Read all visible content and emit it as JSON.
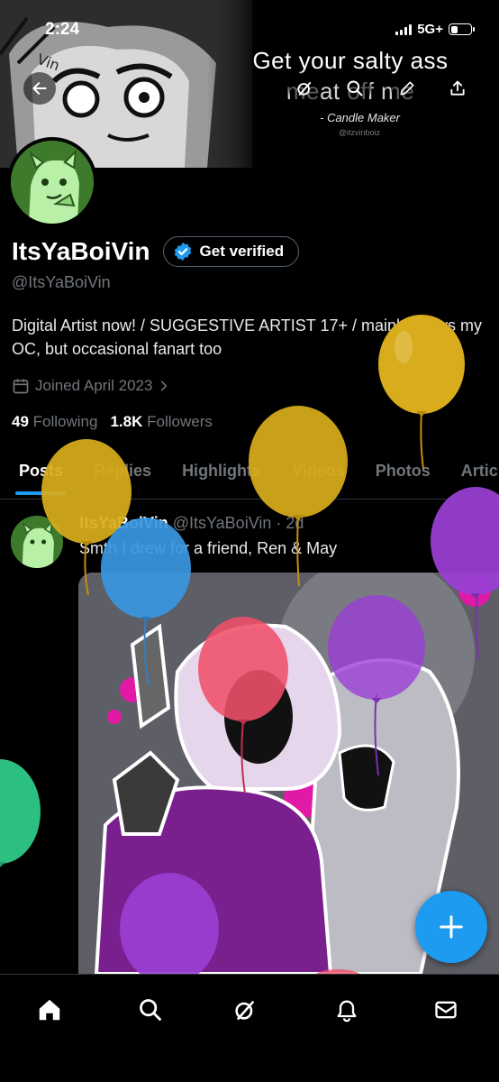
{
  "status_bar": {
    "time": "2:24",
    "network": "5G+"
  },
  "banner": {
    "quote_line1": "Get your salty ass",
    "quote_line2": "meat off me",
    "author": "- Candle Maker",
    "watermark": "@itzvinboiz",
    "sketch_text": "Vin"
  },
  "profile": {
    "display_name": "ItsYaBoiVin",
    "verify_label": "Get verified",
    "handle": "@ItsYaBoiVin",
    "bio": "Digital Artist now! / SUGGESTIVE ARTIST 17+ / mainly draws my OC, but occasional fanart too",
    "joined": "Joined April 2023",
    "following_count": "49",
    "following_label": "Following",
    "followers_count": "1.8K",
    "followers_label": "Followers"
  },
  "tabs": [
    {
      "label": "Posts",
      "active": true
    },
    {
      "label": "Replies"
    },
    {
      "label": "Highlights"
    },
    {
      "label": "Videos"
    },
    {
      "label": "Photos"
    },
    {
      "label": "Articles"
    }
  ],
  "post": {
    "author": "ItsYaBoiVin",
    "handle": "@ItsYaBoiVin",
    "separator": "·",
    "time": "2d",
    "text": "Smth I drew for a friend, Ren & May"
  },
  "colors": {
    "accent": "#1d9bf0",
    "muted": "#71767b",
    "balloon_yellow": "#d8ac1c",
    "balloon_blue": "#3a97e0",
    "balloon_purple": "#9a3fd4",
    "balloon_red": "#f0506a",
    "balloon_green": "#2fcf8a"
  },
  "nav": [
    "home-icon",
    "search-icon",
    "grok-icon",
    "notifications-icon",
    "messages-icon"
  ]
}
